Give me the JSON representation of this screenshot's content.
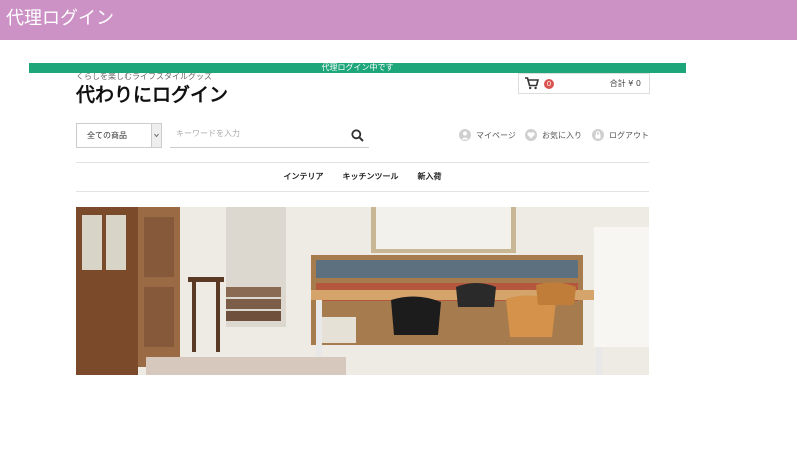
{
  "header": {
    "title": "代理ログイン"
  },
  "banner": {
    "text": "代理ログイン中です"
  },
  "shop": {
    "tagline": "くらしを楽しむライフスタイルグッズ",
    "title": "代わりにログイン"
  },
  "cart": {
    "count": "0",
    "total": "合計 ¥ 0"
  },
  "search": {
    "category": "全ての商品",
    "placeholder": "キーワードを入力"
  },
  "user_links": [
    {
      "label": "マイページ"
    },
    {
      "label": "お気に入り"
    },
    {
      "label": "ログアウト"
    }
  ],
  "nav": [
    {
      "label": "インテリア"
    },
    {
      "label": "キッチンツール"
    },
    {
      "label": "新入荷"
    }
  ],
  "colors": {
    "header_bg": "#cc92c6",
    "banner_bg": "#1ea67b",
    "badge": "#d9534f"
  },
  "icons": {
    "cart": "cart-icon",
    "search": "search-icon",
    "mypage": "user-icon",
    "favorite": "heart-icon",
    "logout": "lock-icon"
  }
}
